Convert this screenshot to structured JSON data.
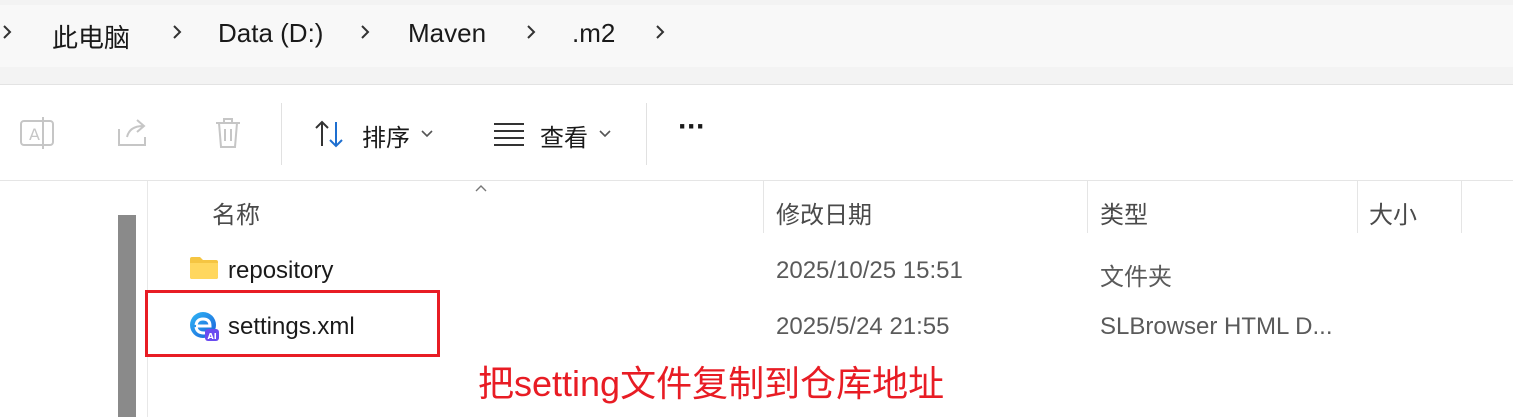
{
  "breadcrumb": {
    "items": [
      "此电脑",
      "Data (D:)",
      "Maven",
      ".m2"
    ]
  },
  "toolbar": {
    "sort_label": "排序",
    "view_label": "查看",
    "more_label": "···"
  },
  "columns": {
    "name": "名称",
    "modified": "修改日期",
    "type": "类型",
    "size": "大小"
  },
  "files": [
    {
      "name": "repository",
      "modified": "2025/10/25 15:51",
      "type": "文件夹",
      "icon": "folder-icon"
    },
    {
      "name": "settings.xml",
      "modified": "2025/5/24 21:55",
      "type": "SLBrowser HTML D...",
      "icon": "slbrowser-html-icon"
    }
  ],
  "annotation": {
    "text": "把setting文件复制到仓库地址",
    "color": "#e81c24"
  },
  "colors": {
    "accent_red": "#e81c24",
    "folder": "#f5c542"
  }
}
